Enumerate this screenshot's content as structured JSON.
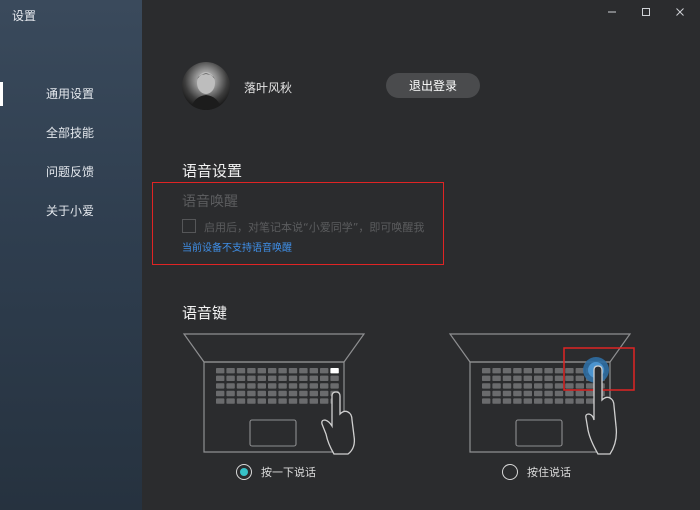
{
  "window": {
    "title": "设置"
  },
  "sidebar": {
    "items": [
      {
        "label": "通用设置",
        "active": true
      },
      {
        "label": "全部技能",
        "active": false
      },
      {
        "label": "问题反馈",
        "active": false
      },
      {
        "label": "关于小爱",
        "active": false
      }
    ]
  },
  "account": {
    "username": "落叶风秋",
    "logout_label": "退出登录"
  },
  "voice_settings": {
    "title": "语音设置",
    "wake_title": "语音唤醒",
    "wake_desc": "启用后，对笔记本说“小爱同学”，即可唤醒我",
    "wake_link": "当前设备不支持语音唤醒"
  },
  "voice_key": {
    "title": "语音键",
    "options": [
      {
        "label": "按一下说话",
        "selected": true
      },
      {
        "label": "按住说话",
        "selected": false
      }
    ]
  },
  "colors": {
    "accent": "#37c2c8",
    "link": "#3f8fe8",
    "highlight_box": "#e02424",
    "sidebar": "#2f3e4f",
    "background": "#2b2c2e"
  }
}
